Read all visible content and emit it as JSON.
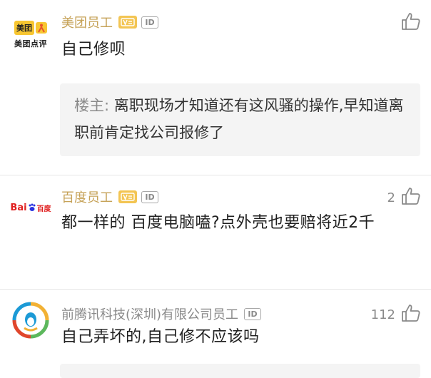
{
  "comments": [
    {
      "avatar_label": "美团点评",
      "avatar_brand": "美团",
      "username": "美团员工",
      "badge_id": "ID",
      "likes": "",
      "text": "自己修呗",
      "quote_author": "楼主:",
      "quote_text": "离职现场才知道还有这风骚的操作,早知道离职前肯定找公司报修了"
    },
    {
      "avatar_label": "Bai百度",
      "username": "百度员工",
      "badge_id": "ID",
      "likes": "2",
      "text": "都一样的 百度电脑嗑?点外壳也要赔将近2千"
    },
    {
      "username": "前腾讯科技(深圳)有限公司员工",
      "badge_id": "ID",
      "likes": "112",
      "text": "自己弄坏的,自己修不应该吗"
    }
  ],
  "colors": {
    "username": "#c6a258",
    "meituan_yellow": "#f7c631",
    "baidu_red": "#e02020",
    "baidu_blue": "#2932e1",
    "tencent_green": "#5cb85c",
    "tencent_blue": "#1c9ad6"
  }
}
